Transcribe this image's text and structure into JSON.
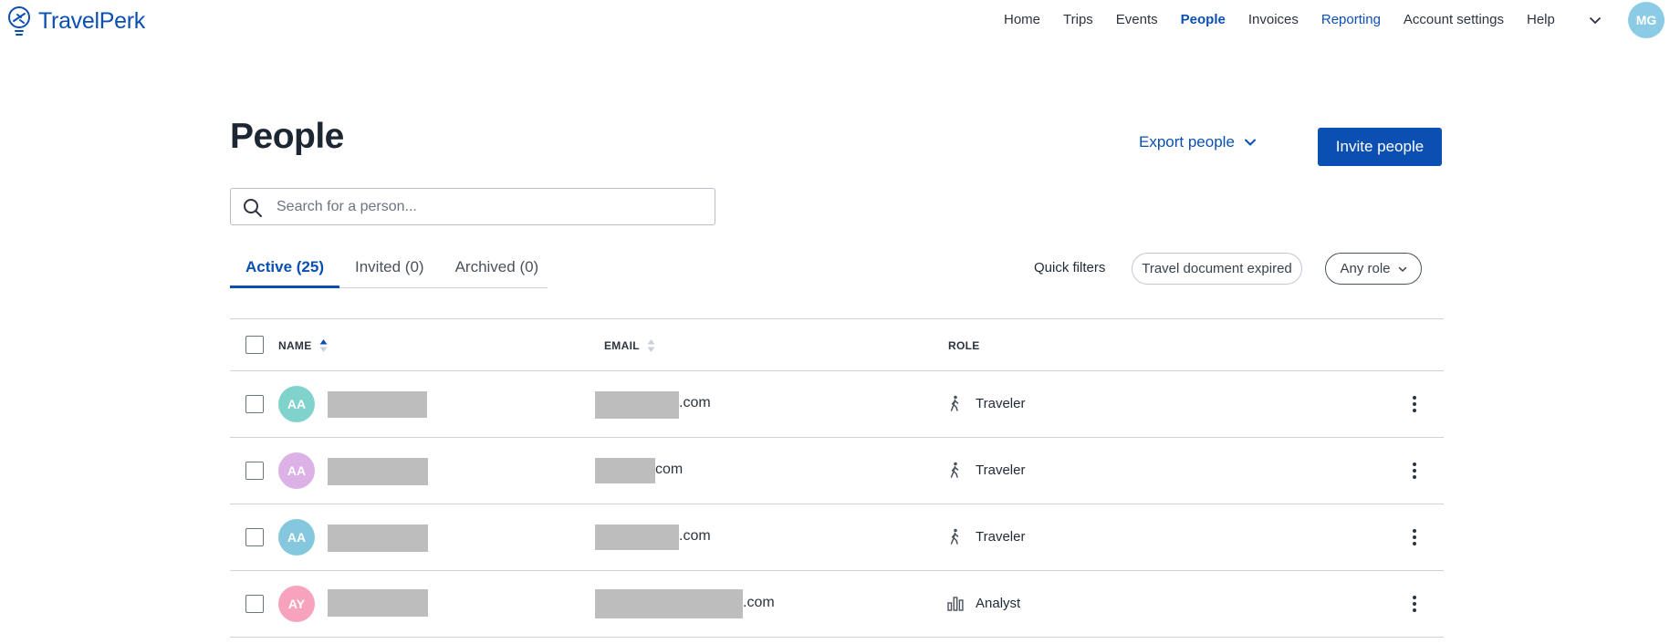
{
  "brand": {
    "name": "TravelPerk"
  },
  "nav": {
    "items": [
      {
        "label": "Home",
        "state": "normal"
      },
      {
        "label": "Trips",
        "state": "normal"
      },
      {
        "label": "Events",
        "state": "normal"
      },
      {
        "label": "People",
        "state": "active"
      },
      {
        "label": "Invoices",
        "state": "normal"
      },
      {
        "label": "Reporting",
        "state": "accent"
      },
      {
        "label": "Account settings",
        "state": "normal"
      },
      {
        "label": "Help",
        "state": "normal"
      }
    ],
    "user_initials": "MG"
  },
  "header": {
    "title": "People",
    "export_label": "Export people",
    "invite_label": "Invite people"
  },
  "search": {
    "placeholder": "Search for a person..."
  },
  "tabs": [
    {
      "label": "Active (25)",
      "active": true
    },
    {
      "label": "Invited (0)",
      "active": false
    },
    {
      "label": "Archived (0)",
      "active": false
    }
  ],
  "filters": {
    "label": "Quick filters",
    "travel_chip": "Travel document expired",
    "role_chip": "Any role"
  },
  "table": {
    "columns": {
      "name": "NAME",
      "email": "EMAIL",
      "role": "ROLE"
    },
    "rows": [
      {
        "initials": "AA",
        "avatar_color": "#7fd3cc",
        "email_suffix": ".com",
        "role": "Traveler",
        "role_icon": "traveler-icon"
      },
      {
        "initials": "AA",
        "avatar_color": "#dcb2e6",
        "email_suffix": "com",
        "role": "Traveler",
        "role_icon": "traveler-icon"
      },
      {
        "initials": "AA",
        "avatar_color": "#85c8de",
        "email_suffix": ".com",
        "role": "Traveler",
        "role_icon": "traveler-icon"
      },
      {
        "initials": "AY",
        "avatar_color": "#f7a3bd",
        "email_suffix": ".com",
        "role": "Analyst",
        "role_icon": "analyst-icon"
      }
    ]
  },
  "colors": {
    "accent": "#0b4fb3",
    "redaction": "#bdbdbd",
    "avatar_user": "#8ccbe6"
  }
}
